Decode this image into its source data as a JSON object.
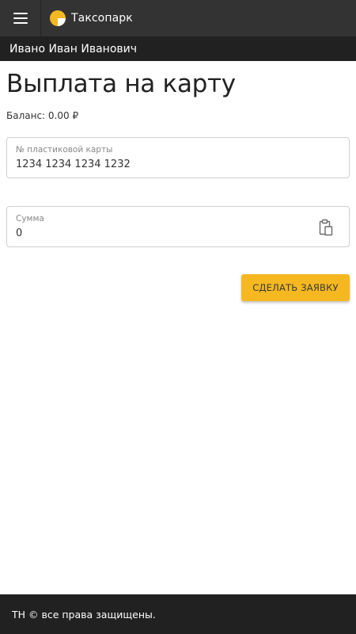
{
  "header": {
    "brand": "Таксопарк",
    "menu_icon": "hamburger-menu-icon",
    "logo_icon": "taxi-logo-icon",
    "accent_color": "#f5b820"
  },
  "user": {
    "full_name": "Ивано Иван Иванович"
  },
  "page": {
    "title": "Выплата на карту",
    "balance": "Баланс: 0.00 ₽"
  },
  "form": {
    "card": {
      "label": "№ пластиковой карты",
      "value": "1234 1234 1234 1232"
    },
    "sum": {
      "label": "Сумма",
      "value": "0",
      "icon": "clipboard-paste-icon"
    },
    "submit_label": "СДЕЛАТЬ ЗАЯВКУ"
  },
  "footer": {
    "text": "ТН © все права защищены."
  }
}
